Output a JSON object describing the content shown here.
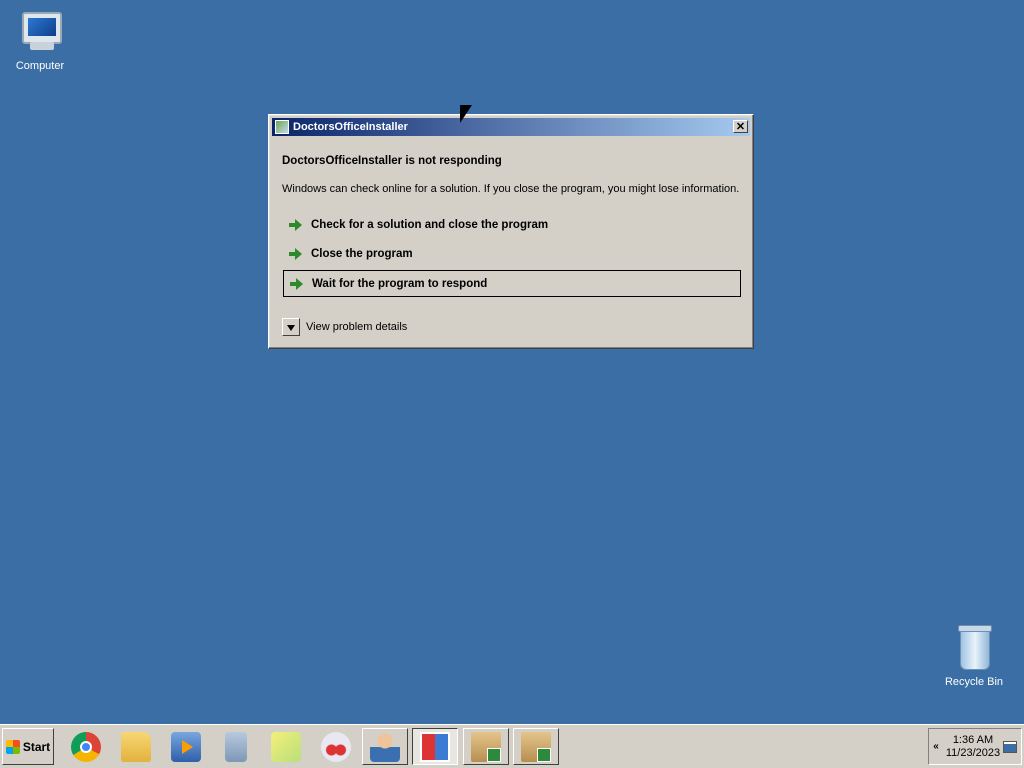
{
  "desktop": {
    "icons": [
      {
        "label": "Computer"
      },
      {
        "label": "Recycle Bin"
      }
    ]
  },
  "dialog": {
    "title": "DoctorsOfficeInstaller",
    "close_label": "✕",
    "heading": "DoctorsOfficeInstaller is not responding",
    "message": "Windows can check online for a solution. If you close the program, you might lose information.",
    "options": [
      {
        "label": "Check for a solution and close the program"
      },
      {
        "label": "Close the program"
      },
      {
        "label": "Wait for the program to respond"
      }
    ],
    "details_label": "View problem details"
  },
  "taskbar": {
    "start_label": "Start",
    "apps": [
      {
        "icon": "chrome-icon"
      },
      {
        "icon": "folder-icon"
      },
      {
        "icon": "media-player-icon"
      },
      {
        "icon": "calculator-icon"
      },
      {
        "icon": "sticky-notes-icon"
      },
      {
        "icon": "snipping-tool-icon"
      },
      {
        "icon": "user-icon"
      },
      {
        "icon": "app-window-icon"
      },
      {
        "icon": "installer-package-icon"
      },
      {
        "icon": "installer-package-icon"
      }
    ],
    "tray": {
      "chevron": "«",
      "time": "1:36 AM",
      "date": "11/23/2023"
    }
  },
  "colors": {
    "desktop_background": "#3a6ea5",
    "title_bar_start": "#0a246a",
    "title_bar_end": "#a6caf0",
    "dialog_face": "#d4d0c8"
  }
}
